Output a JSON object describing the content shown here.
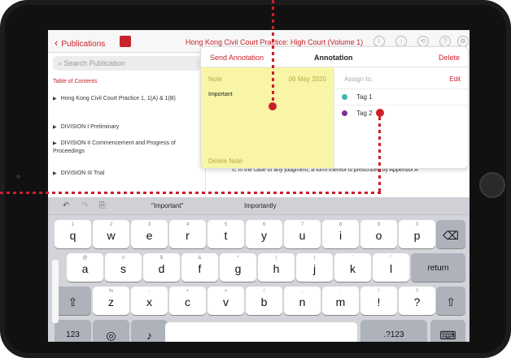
{
  "header": {
    "back_label": "Publications",
    "title": "Hong Kong Civil Court Practice: High Court (Volume 1)"
  },
  "sidebar": {
    "search_placeholder": "Search Publication",
    "toc_label": "Table of Contents",
    "items": [
      "Hong Kong Civil Court Practice 1, 1(A) & 1(B)",
      "DIVISION I Preliminary",
      "DIVISION II Commencement and Progress of Proceedings",
      "DIVISION III Trial"
    ]
  },
  "annotation": {
    "send_label": "Send Annotation",
    "title": "Annotation",
    "delete_label": "Delete",
    "note_label": "Note",
    "date": "06 May 2020",
    "note_text": "Important",
    "delete_note_label": "Delete Note",
    "assign_label": "Assign to:",
    "edit_label": "Edit",
    "tags": [
      {
        "label": "Tag 1",
        "color": "#3bb5b0"
      },
      {
        "label": "Tag 2",
        "color": "#7a2e8f"
      }
    ]
  },
  "content": {
    "text": "If, in the case of any judgment, a form thereof is prescribed by Appendix A"
  },
  "keyboard": {
    "suggestions": [
      "\"Important\"",
      "Importantly"
    ],
    "rows": {
      "r1": [
        {
          "label": "q",
          "sub": "1"
        },
        {
          "label": "w",
          "sub": "2"
        },
        {
          "label": "e",
          "sub": "3"
        },
        {
          "label": "r",
          "sub": "4"
        },
        {
          "label": "t",
          "sub": "5"
        },
        {
          "label": "y",
          "sub": "6"
        },
        {
          "label": "u",
          "sub": "7"
        },
        {
          "label": "i",
          "sub": "8"
        },
        {
          "label": "o",
          "sub": "9"
        },
        {
          "label": "p",
          "sub": "0"
        }
      ],
      "r2": [
        {
          "label": "a",
          "sub": "@"
        },
        {
          "label": "s",
          "sub": "#"
        },
        {
          "label": "d",
          "sub": "$"
        },
        {
          "label": "f",
          "sub": "&"
        },
        {
          "label": "g",
          "sub": "*"
        },
        {
          "label": "h",
          "sub": "("
        },
        {
          "label": "j",
          "sub": ")"
        },
        {
          "label": "k",
          "sub": "'"
        },
        {
          "label": "l",
          "sub": "\""
        }
      ],
      "r3": [
        {
          "label": "z",
          "sub": "%"
        },
        {
          "label": "x",
          "sub": "-"
        },
        {
          "label": "c",
          "sub": "+"
        },
        {
          "label": "v",
          "sub": "="
        },
        {
          "label": "b",
          "sub": "/"
        },
        {
          "label": "n",
          "sub": ";"
        },
        {
          "label": "m",
          "sub": ":"
        },
        {
          "label": "!",
          "sub": "!"
        },
        {
          "label": "?",
          "sub": "?"
        }
      ]
    },
    "return_label": "return",
    "num_label": ".?123",
    "num_left_label": "123"
  },
  "colors": {
    "accent": "#c8232c",
    "note_bg": "#f8f5a6"
  }
}
